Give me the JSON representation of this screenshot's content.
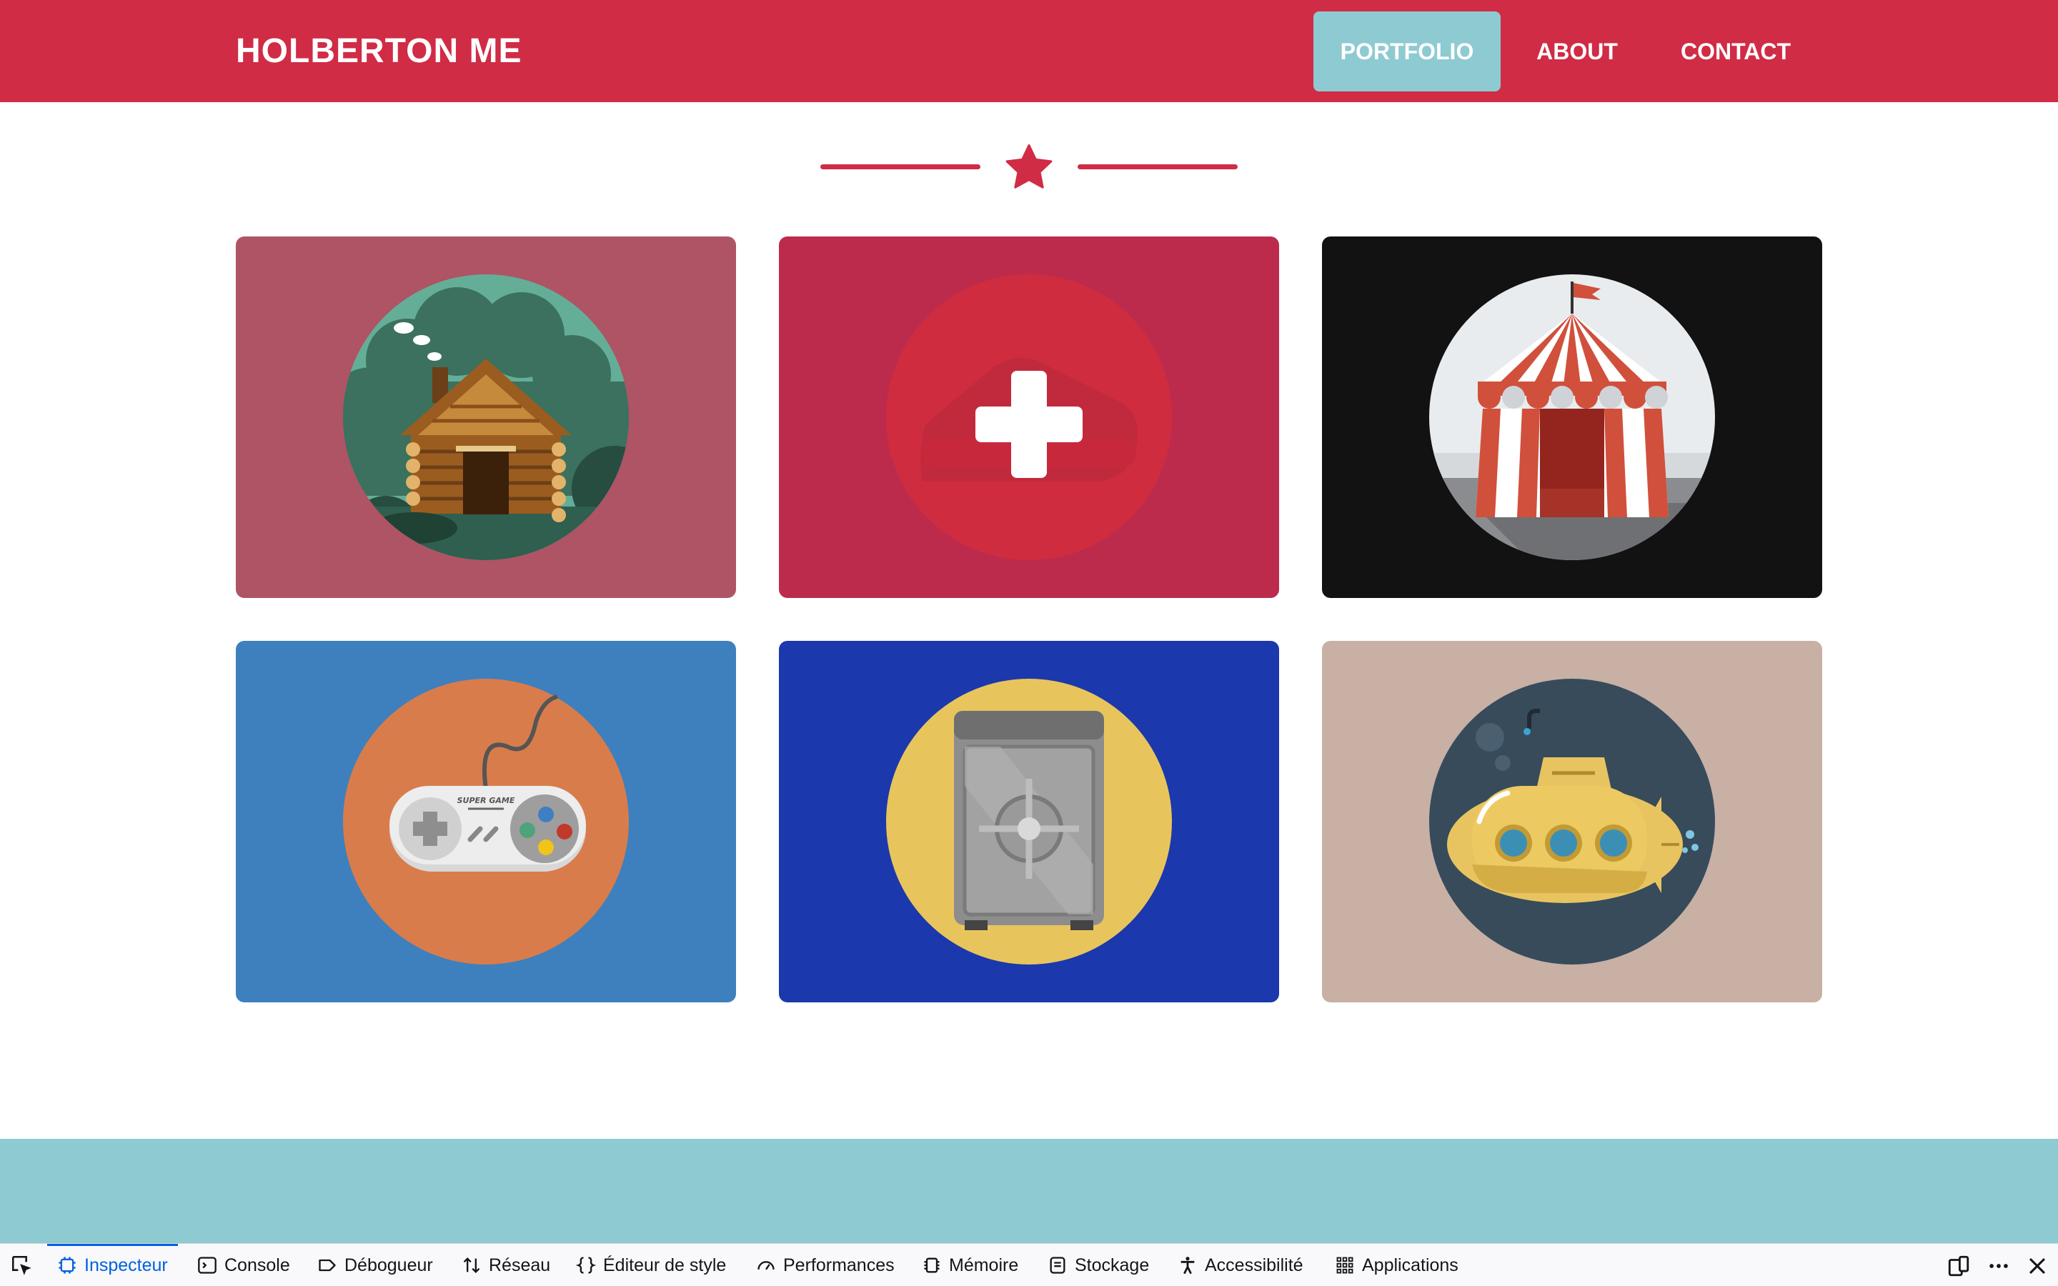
{
  "header": {
    "brand": "HOLBERTON ME",
    "nav": [
      {
        "label": "PORTFOLIO",
        "active": true
      },
      {
        "label": "ABOUT",
        "active": false
      },
      {
        "label": "CONTACT",
        "active": false
      }
    ]
  },
  "colors": {
    "brand_red": "#d02c45",
    "accent_teal": "#8ecad2",
    "tile_backgrounds": [
      "#ae5465",
      "#bd2b4c",
      "#121212",
      "#3d80bd",
      "#1b38ac",
      "#c8b0a5"
    ]
  },
  "portfolio": {
    "tiles": [
      {
        "icon": "log-cabin-icon"
      },
      {
        "icon": "plus-icon"
      },
      {
        "icon": "circus-tent-icon"
      },
      {
        "icon": "game-controller-icon"
      },
      {
        "icon": "safe-icon"
      },
      {
        "icon": "submarine-icon"
      }
    ],
    "controller_text": "SUPER GAME"
  },
  "devtools": {
    "tabs": [
      {
        "label": "Inspecteur",
        "icon": "inspector-icon",
        "selected": true
      },
      {
        "label": "Console",
        "icon": "console-icon",
        "selected": false
      },
      {
        "label": "Débogueur",
        "icon": "debugger-icon",
        "selected": false
      },
      {
        "label": "Réseau",
        "icon": "network-icon",
        "selected": false
      },
      {
        "label": "Éditeur de style",
        "icon": "style-editor-icon",
        "selected": false
      },
      {
        "label": "Performances",
        "icon": "performance-icon",
        "selected": false
      },
      {
        "label": "Mémoire",
        "icon": "memory-icon",
        "selected": false
      },
      {
        "label": "Stockage",
        "icon": "storage-icon",
        "selected": false
      },
      {
        "label": "Accessibilité",
        "icon": "accessibility-icon",
        "selected": false
      },
      {
        "label": "Applications",
        "icon": "applications-icon",
        "selected": false
      }
    ]
  }
}
